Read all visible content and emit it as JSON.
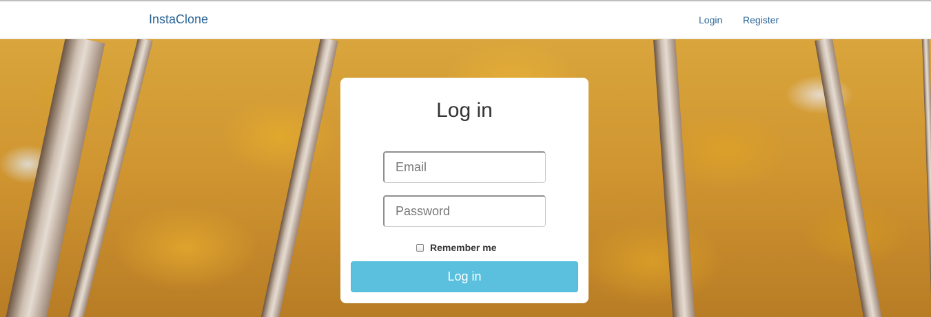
{
  "navbar": {
    "brand": "InstaClone",
    "links": [
      {
        "label": "Login"
      },
      {
        "label": "Register"
      }
    ]
  },
  "login_card": {
    "title": "Log in",
    "email_placeholder": "Email",
    "password_placeholder": "Password",
    "remember_label": "Remember me",
    "remember_checked": false,
    "submit_label": "Log in"
  },
  "colors": {
    "brand_link": "#2a6496",
    "submit_button": "#5bc0de",
    "background_theme": "autumn-forest"
  }
}
